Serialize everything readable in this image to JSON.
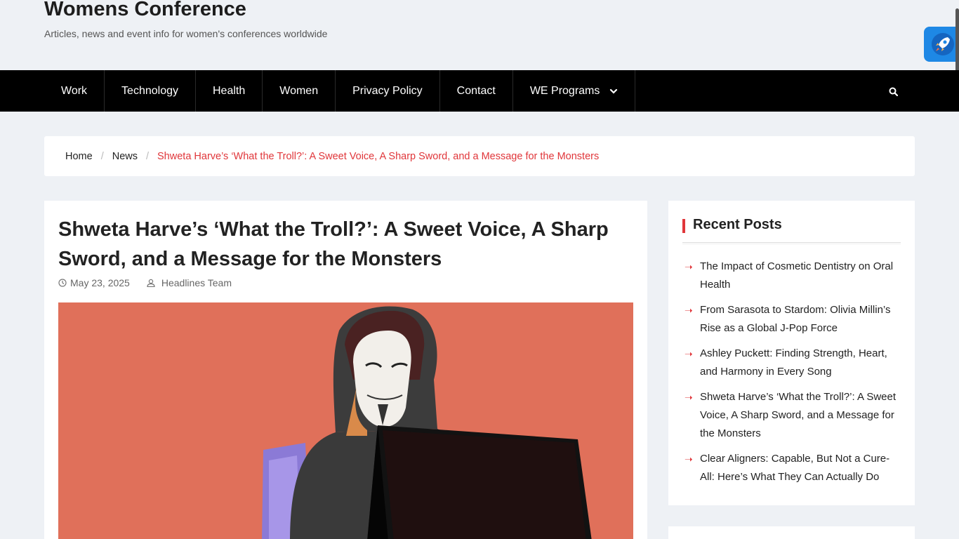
{
  "site": {
    "title": "Womens Conference",
    "tagline": "Articles, news and event info for women's conferences worldwide"
  },
  "nav": {
    "items": [
      "Work",
      "Technology",
      "Health",
      "Women",
      "Privacy Policy",
      "Contact",
      "WE Programs"
    ],
    "search_icon": "search-icon",
    "dropdown_icon": "chevron-down-icon"
  },
  "breadcrumb": {
    "home": "Home",
    "section": "News",
    "current": "Shweta Harve’s ‘What the Troll?’: A Sweet Voice, A Sharp Sword, and a Message for the Monsters"
  },
  "post": {
    "title": "Shweta Harve’s ‘What the Troll?’: A Sweet Voice, A Sharp Sword, and a Message for the Monsters",
    "date": "May 23, 2025",
    "author": "Headlines Team"
  },
  "sidebar": {
    "recent_title": "Recent Posts",
    "recent_posts": [
      "The Impact of Cosmetic Dentistry on Oral Health",
      "From Sarasota to Stardom: Olivia Millin’s Rise as a Global J-Pop Force",
      "Ashley Puckett: Finding Strength, Heart, and Harmony in Every Song",
      "Shweta Harve’s ‘What the Troll?’: A Sweet Voice, A Sharp Sword, and a Message for the Monsters",
      "Clear Aligners: Capable, But Not a Cure-All: Here’s What They Can Actually Do"
    ]
  },
  "colors": {
    "accent": "#e0363a",
    "nav_bg": "#000000",
    "page_bg": "#eef1f5",
    "rocket_bg": "#1e88e5",
    "image_bg": "#e0705a"
  }
}
